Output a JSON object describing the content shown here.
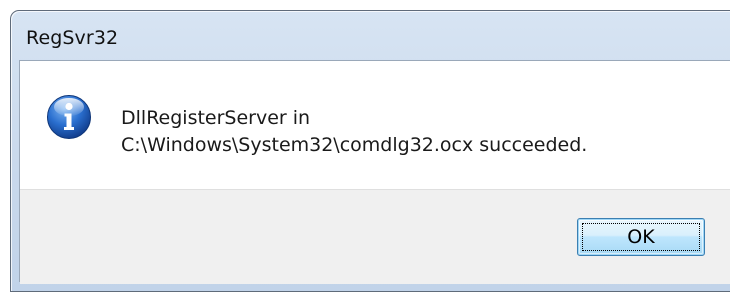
{
  "window": {
    "title": "RegSvr32"
  },
  "dialog": {
    "icon": "info-icon",
    "message_line1": "DllRegisterServer in",
    "message_line2": "C:\\Windows\\System32\\comdlg32.ocx succeeded."
  },
  "buttons": {
    "ok_label": "OK"
  },
  "colors": {
    "frame": "#c9d9ec",
    "footer": "#f0f0f0",
    "icon_blue": "#1e5fb8",
    "button_border": "#3c7fb1"
  }
}
